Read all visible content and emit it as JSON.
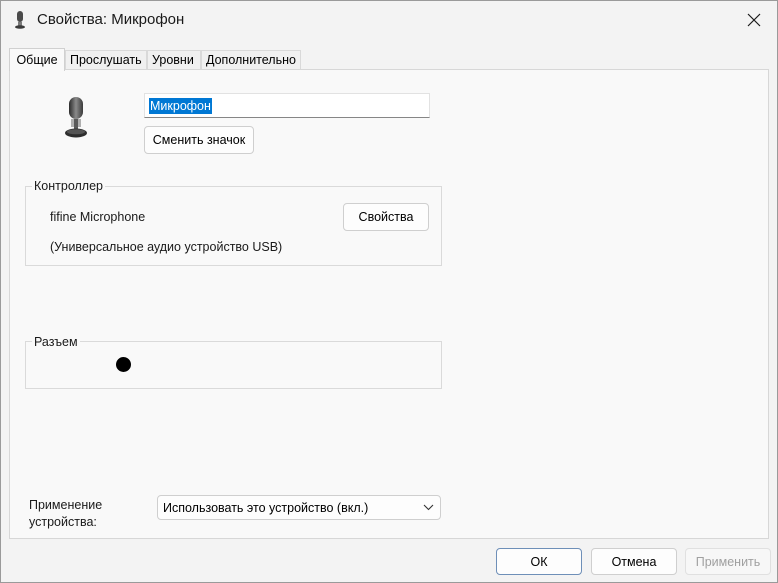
{
  "window": {
    "title": "Свойства: Микрофон",
    "close_icon": "close-icon"
  },
  "tabs": [
    {
      "label": "Общие",
      "active": true
    },
    {
      "label": "Прослушать",
      "active": false
    },
    {
      "label": "Уровни",
      "active": false
    },
    {
      "label": "Дополнительно",
      "active": false
    }
  ],
  "general": {
    "device_icon": "microphone-icon",
    "device_name": "Микрофон",
    "change_icon_button": "Сменить значок",
    "controller": {
      "group_label": "Контроллер",
      "name": "fifine Microphone",
      "description": "(Универсальное аудио устройство USB)",
      "properties_button": "Свойства"
    },
    "jack": {
      "group_label": "Разъем",
      "indicator_color": "#000000"
    },
    "usage": {
      "label_line1": "Применение",
      "label_line2": "устройства:",
      "selected": "Использовать это устройство (вкл.)"
    }
  },
  "footer": {
    "ok": "ОК",
    "cancel": "Отмена",
    "apply": "Применить",
    "apply_enabled": false
  },
  "colors": {
    "selection": "#0078d4",
    "ok_border": "#6e8fb8"
  }
}
